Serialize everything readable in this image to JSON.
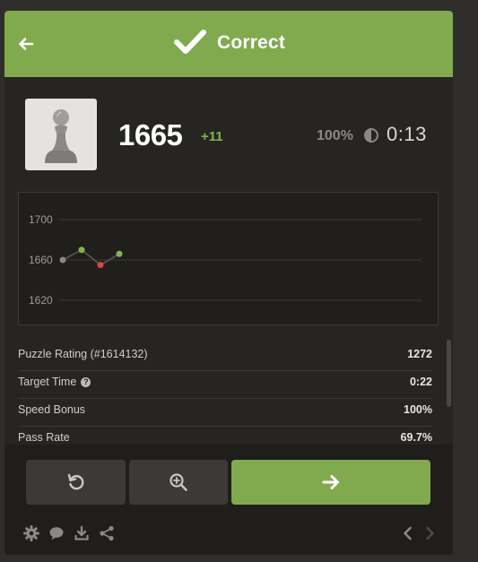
{
  "header": {
    "title": "Correct",
    "back_icon": "arrow-left-icon",
    "status_icon": "checkmark-icon",
    "color": "#81aa4f"
  },
  "player": {
    "avatar_icon": "pawn-icon",
    "rating": "1665",
    "rating_change": "+11",
    "accuracy": "100%",
    "accuracy_icon": "half-circle-icon",
    "time": "0:13",
    "change_color": "#81b64c"
  },
  "chart_data": {
    "type": "line",
    "x": [
      1,
      2,
      3,
      4
    ],
    "series": [
      {
        "values": [
          1660,
          1670,
          1655,
          1666
        ],
        "point_colors": [
          "#8b8987",
          "#81b64c",
          "#d14a3b",
          "#81b64c"
        ]
      }
    ],
    "ytick_labels": [
      "1700",
      "1660",
      "1620"
    ],
    "yticks": [
      1700,
      1660,
      1620
    ],
    "ylim": [
      1620,
      1700
    ],
    "grid": true
  },
  "stats": [
    {
      "label": "Puzzle Rating (#1614132)",
      "value": "1272",
      "help": false
    },
    {
      "label": "Target Time",
      "value": "0:22",
      "help": true
    },
    {
      "label": "Speed Bonus",
      "value": "100%",
      "help": false
    },
    {
      "label": "Pass Rate",
      "value": "69.7%",
      "help": false
    }
  ],
  "actions": {
    "retry_icon": "retry-icon",
    "analyze_icon": "magnify-analysis-icon",
    "next_icon": "arrow-right-icon"
  },
  "footer": {
    "icons": [
      "gear-icon",
      "chat-icon",
      "download-icon",
      "share-icon",
      "chevron-left-icon",
      "chevron-right-icon"
    ]
  }
}
